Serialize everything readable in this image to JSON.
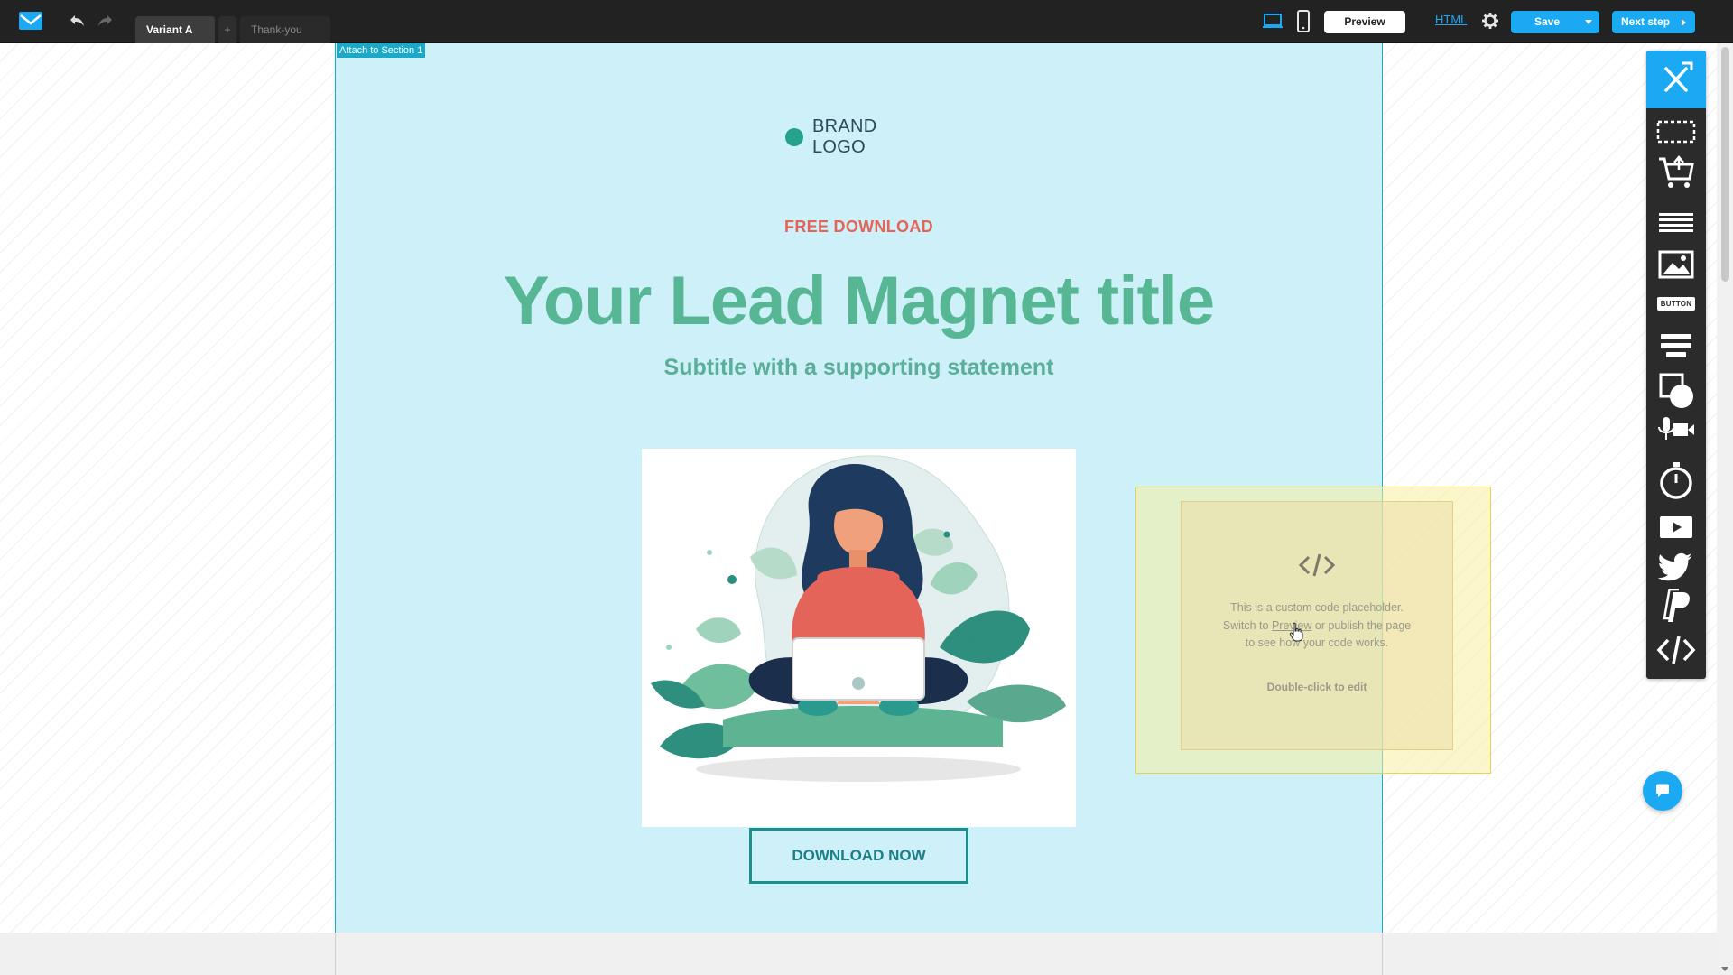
{
  "toolbar": {
    "tabs": [
      {
        "label": "Variant A"
      },
      {
        "label": "+"
      },
      {
        "label": "Thank-you page"
      }
    ],
    "preview_label": "Preview",
    "html_label": "HTML",
    "save_label": "Save",
    "next_label": "Next step"
  },
  "canvas": {
    "attach_label": "Attach to Section 1",
    "brand_logo": "BRAND LOGO",
    "eyebrow": "FREE DOWNLOAD",
    "headline": "Your Lead Magnet title",
    "subtitle": "Subtitle with a supporting statement",
    "cta_label": "DOWNLOAD NOW"
  },
  "code_placeholder": {
    "line1": "This is a custom code placeholder.",
    "line2_pre": "Switch to ",
    "line2_link": "Preview",
    "line2_post": " or publish the page",
    "line3": "to see how your code works.",
    "edit_hint": "Double-click to edit"
  },
  "tools_panel": {
    "button_tool_label": "BUTTON"
  },
  "colors": {
    "accent": "#1aa9f2",
    "section_bg": "#cdf0f9",
    "headline": "#57b794",
    "eyebrow": "#e4645a",
    "topbar": "#222222"
  },
  "icons": [
    "logo-icon",
    "undo-icon",
    "redo-icon",
    "desktop-view-icon",
    "mobile-view-icon",
    "gear-icon",
    "chevron-down-icon",
    "caret-right-icon",
    "tools-icon",
    "section-icon",
    "cart-icon",
    "text-icon",
    "image-icon",
    "button-icon",
    "form-icon",
    "shapes-icon",
    "media-icon",
    "timer-icon",
    "video-icon",
    "twitter-icon",
    "paypal-icon",
    "code-icon",
    "chat-icon",
    "hand-cursor-icon"
  ]
}
